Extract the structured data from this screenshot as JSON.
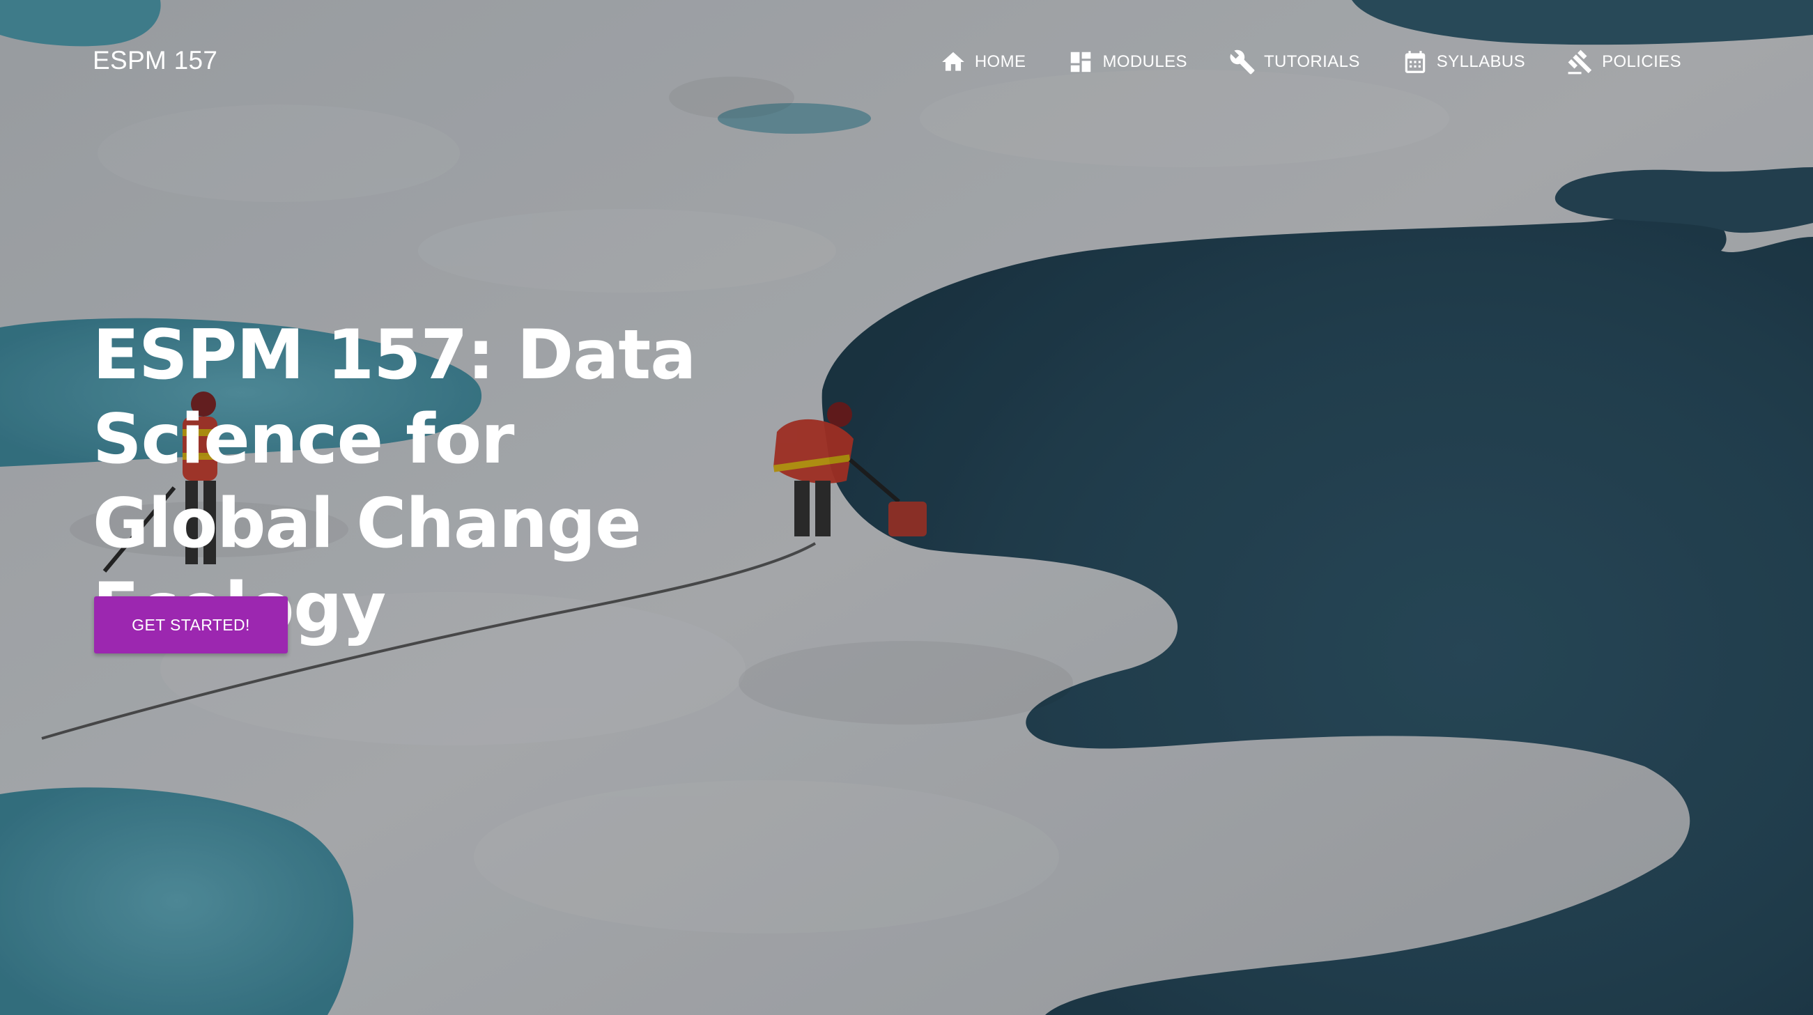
{
  "brand": {
    "title": "ESPM 157"
  },
  "nav": {
    "items": [
      {
        "label": "HOME",
        "icon": "home-icon"
      },
      {
        "label": "MODULES",
        "icon": "dashboard-icon"
      },
      {
        "label": "TUTORIALS",
        "icon": "wrench-icon"
      },
      {
        "label": "SYLLABUS",
        "icon": "calendar-icon"
      },
      {
        "label": "POLICIES",
        "icon": "gavel-icon"
      }
    ]
  },
  "hero": {
    "headline": "ESPM 157: Data Science for Global Change Ecology",
    "cta_label": "GET STARTED!",
    "background": "arctic-sea-ice-melt-ponds-photo"
  },
  "colors": {
    "accent": "#9c27b0",
    "text": "#ffffff",
    "water_dark": "#2c4f63",
    "water_light": "#4c93a8",
    "ice": "#c9ccd0"
  }
}
